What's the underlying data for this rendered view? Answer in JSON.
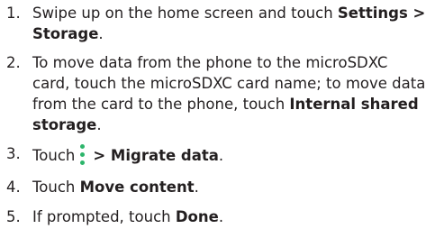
{
  "steps": [
    {
      "number": "1.",
      "lines": [
        {
          "text": "Swipe up on the home screen and touch ",
          "bold": "Settings >"
        },
        {
          "bold": "Storage",
          "after": "."
        }
      ]
    },
    {
      "number": "2.",
      "lines": [
        {
          "text": "To move data from the phone to the microSDXC"
        },
        {
          "text": "card, touch the microSDXC card name; to move data"
        },
        {
          "text": "from the card to the phone, touch ",
          "bold": "Internal shared"
        },
        {
          "bold": "storage",
          "after": "."
        }
      ]
    },
    {
      "number": "3.",
      "before": "Touch",
      "bold": "> Migrate data",
      "after": "."
    },
    {
      "number": "4.",
      "before": "Touch ",
      "bold": "Move content",
      "after": "."
    },
    {
      "number": "5.",
      "before": "If prompted, touch ",
      "bold": "Done",
      "after": "."
    }
  ],
  "icons": {
    "menu_icon_name": "more-vert-icon",
    "menu_icon_color": "#2db56b"
  },
  "colors": {
    "text": "#231f20"
  }
}
